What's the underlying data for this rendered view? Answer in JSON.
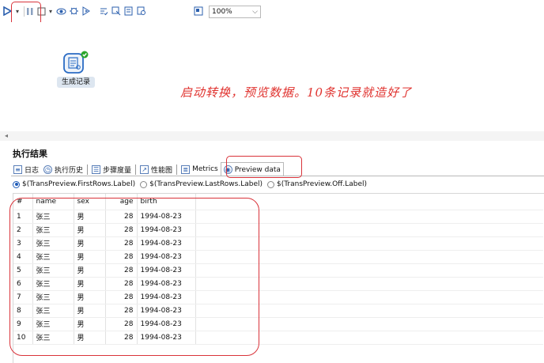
{
  "toolbar": {
    "zoom_value": "100%",
    "icons": [
      "run-icon",
      "dropdown-arrow-icon",
      "pause-icon",
      "stop-icon",
      "dropdown-arrow-icon",
      "preview-icon",
      "debug-icon",
      "replay-icon",
      "check-icon",
      "impact-icon",
      "sql-icon",
      "explore-db-icon",
      "layout-icon"
    ]
  },
  "canvas": {
    "step_label": "生成记录",
    "annotation": "启动转换，预览数据。10条记录就造好了"
  },
  "results": {
    "title": "执行结果",
    "tabs": [
      {
        "label": "日志",
        "icon": "log-icon"
      },
      {
        "label": "执行历史",
        "icon": "history-icon"
      },
      {
        "label": "步骤度量",
        "icon": "step-metrics-icon"
      },
      {
        "label": "性能图",
        "icon": "perf-graph-icon"
      },
      {
        "label": "Metrics",
        "icon": "metrics-icon"
      },
      {
        "label": "Preview data",
        "icon": "eye-icon"
      }
    ],
    "active_tab": "Preview data",
    "radio_options": [
      "$(TransPreview.FirstRows.Label)",
      "$(TransPreview.LastRows.Label)",
      "$(TransPreview.Off.Label)"
    ],
    "radio_selected": "$(TransPreview.FirstRows.Label)"
  },
  "table": {
    "columns": [
      "#",
      "name",
      "sex",
      "age",
      "birth"
    ],
    "rows": [
      [
        "1",
        "张三",
        "男",
        "28",
        "1994-08-23"
      ],
      [
        "2",
        "张三",
        "男",
        "28",
        "1994-08-23"
      ],
      [
        "3",
        "张三",
        "男",
        "28",
        "1994-08-23"
      ],
      [
        "4",
        "张三",
        "男",
        "28",
        "1994-08-23"
      ],
      [
        "5",
        "张三",
        "男",
        "28",
        "1994-08-23"
      ],
      [
        "6",
        "张三",
        "男",
        "28",
        "1994-08-23"
      ],
      [
        "7",
        "张三",
        "男",
        "28",
        "1994-08-23"
      ],
      [
        "8",
        "张三",
        "男",
        "28",
        "1994-08-23"
      ],
      [
        "9",
        "张三",
        "男",
        "28",
        "1994-08-23"
      ],
      [
        "10",
        "张三",
        "男",
        "28",
        "1994-08-23"
      ]
    ]
  },
  "colors": {
    "annotation_red": "#e0332f",
    "accent_blue": "#2b5fae",
    "success_green": "#2aa52a"
  }
}
